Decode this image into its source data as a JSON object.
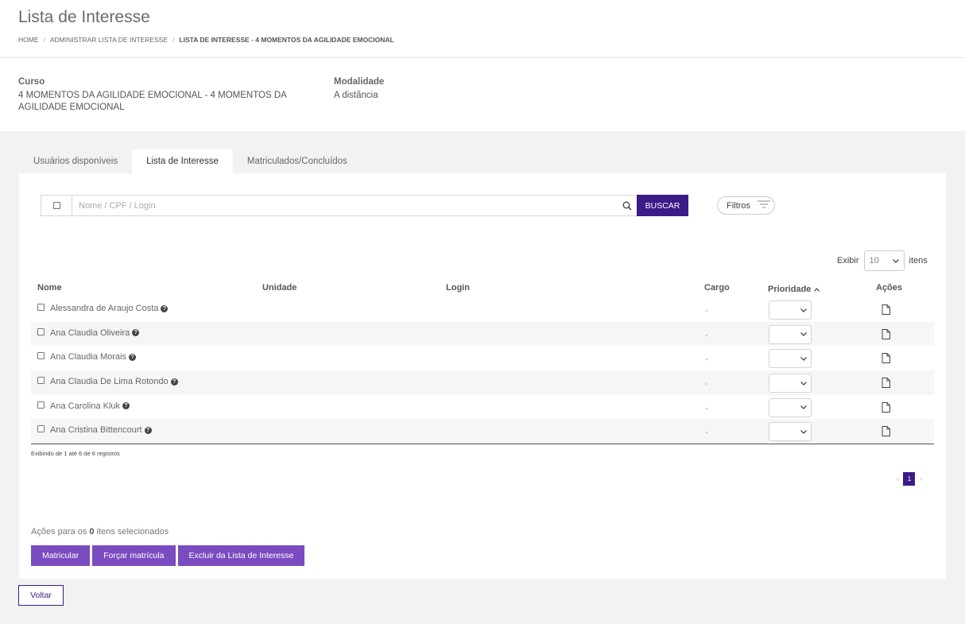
{
  "page": {
    "title": "Lista de Interesse"
  },
  "breadcrumb": [
    {
      "label": "HOME"
    },
    {
      "label": "ADMINISTRAR LISTA DE INTERESSE"
    },
    {
      "label": "LISTA DE INTERESSE - 4 MOMENTOS DA AGILIDADE EMOCIONAL"
    }
  ],
  "course": {
    "curso_label": "Curso",
    "curso_value": "4 MOMENTOS DA AGILIDADE EMOCIONAL - 4 MOMENTOS DA AGILIDADE EMOCIONAL",
    "modalidade_label": "Modalidade",
    "modalidade_value": "A distância"
  },
  "tabs": [
    {
      "label": "Usuários disponíveis",
      "active": false
    },
    {
      "label": "Lista de Interesse",
      "active": true
    },
    {
      "label": "Matriculados/Concluídos",
      "active": false
    }
  ],
  "search": {
    "placeholder": "Nome / CPF / Login",
    "value": "",
    "button_label": "BUSCAR",
    "filters_label": "Filtros"
  },
  "pagesize": {
    "label_before": "Exibir",
    "value": "10",
    "label_after": "itens"
  },
  "table": {
    "headers": {
      "nome": "Nome",
      "unidade": "Unidade",
      "login": "Login",
      "cargo": "Cargo",
      "prioridade": "Prioridade",
      "acoes": "Ações"
    },
    "rows": [
      {
        "nome": "Alessandra de Araujo Costa",
        "unidade": "",
        "login": "",
        "cargo": "-"
      },
      {
        "nome": "Ana Claudia Oliveira",
        "unidade": "",
        "login": "",
        "cargo": "-"
      },
      {
        "nome": "Ana Claudia Morais",
        "unidade": "",
        "login": "",
        "cargo": "-"
      },
      {
        "nome": "Ana Claudia De Lima Rotondo",
        "unidade": "",
        "login": "",
        "cargo": "-"
      },
      {
        "nome": "Ana Carolina Kluk",
        "unidade": "",
        "login": "",
        "cargo": "-"
      },
      {
        "nome": "Ana Cristina Bittencourt",
        "unidade": "",
        "login": "",
        "cargo": "-"
      }
    ],
    "footer": "Exibindo de 1 até 6 de 6 registros"
  },
  "pagination": {
    "prev": "«",
    "current": "1",
    "next": "»"
  },
  "bulk": {
    "prefix": "Ações para os",
    "count": "0",
    "suffix": "itens selecionados",
    "buttons": [
      "Matricular",
      "Forçar matrícula",
      "Excluir da Lista de Interesse"
    ]
  },
  "voltar_label": "Voltar",
  "colors": {
    "primary": "#3c1a87",
    "action": "#7b4bc0",
    "background": "#f2f2f2"
  }
}
